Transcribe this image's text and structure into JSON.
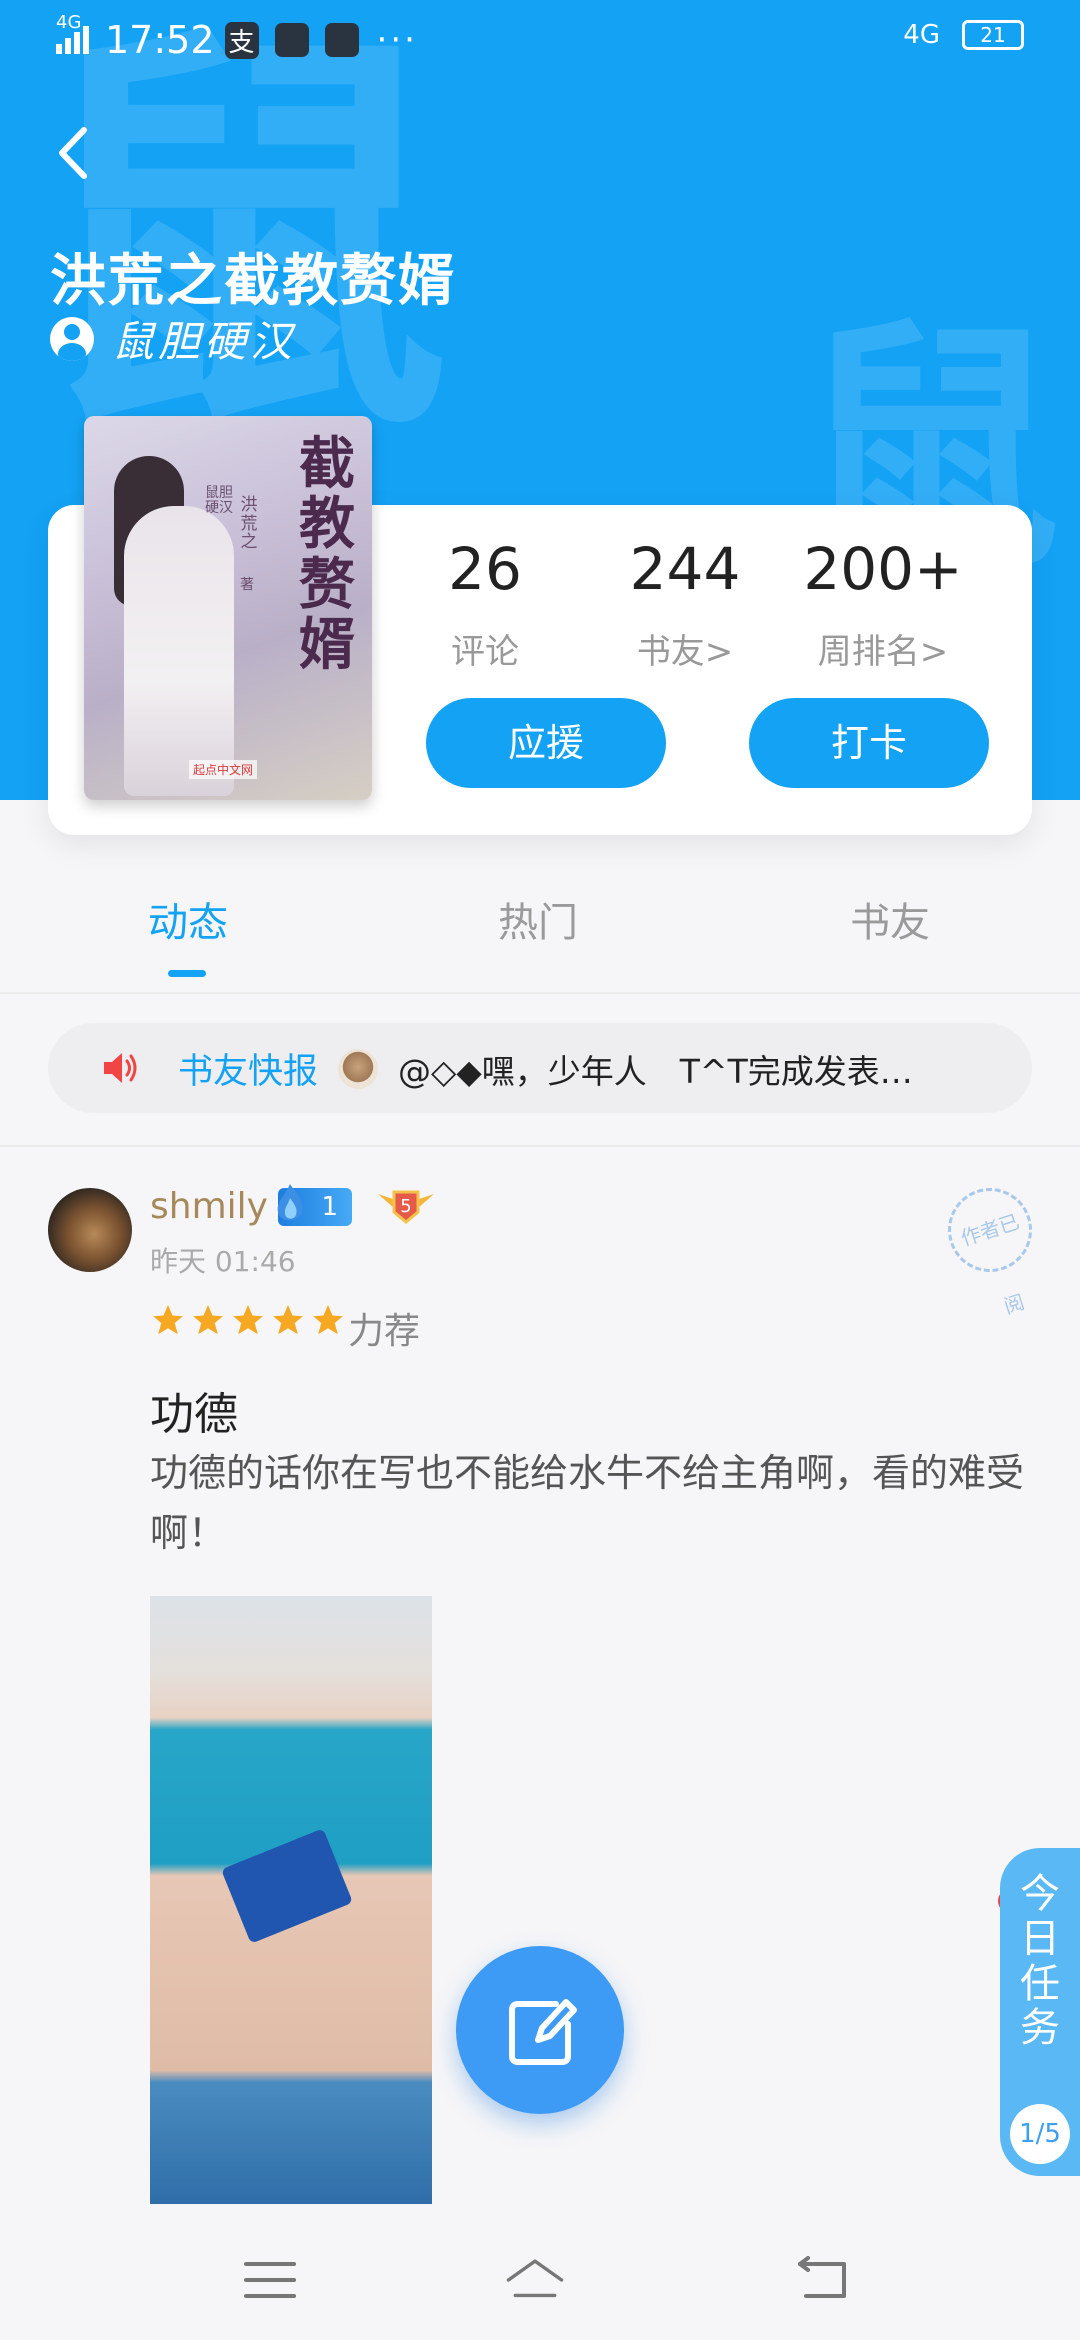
{
  "status_bar": {
    "network": "4G",
    "time": "17:52",
    "app_icons": [
      "支"
    ],
    "more": "···",
    "right_network": "4G",
    "battery": "21"
  },
  "header": {
    "watermark_char": "鼠",
    "title": "洪荒之截教赘婿",
    "author": "鼠胆硬汉"
  },
  "cover": {
    "title_chars": "截教赘婿",
    "prefix": "洪荒之",
    "author": "鼠胆硬汉",
    "author_suffix": "著",
    "publisher": "起点中文网"
  },
  "stats": [
    {
      "value": "26",
      "label": "评论"
    },
    {
      "value": "244",
      "label": "书友>"
    },
    {
      "value": "200+",
      "label": "周排名>"
    }
  ],
  "actions": {
    "support": "应援",
    "checkin": "打卡"
  },
  "tabs": [
    "动态",
    "热门",
    "书友"
  ],
  "ticker": {
    "label": "书友快报",
    "text": "@◇◆嘿，少年人　T^T完成发表…"
  },
  "post": {
    "username": "shmily",
    "level": "1",
    "fans_level": "5",
    "time": "昨天 01:46",
    "stamp": "作者已阅",
    "rating": 5,
    "rating_text": "力荐",
    "title": "功德",
    "body": "功德的话你在写也不能给水牛不给主角啊，看的难受啊！"
  },
  "daily_task": {
    "label": "今日任务",
    "progress": "1/5"
  },
  "colors": {
    "primary": "#14a2f5",
    "background": "#f6f6f8",
    "star": "#f7a823",
    "badge_red": "#f14545"
  }
}
